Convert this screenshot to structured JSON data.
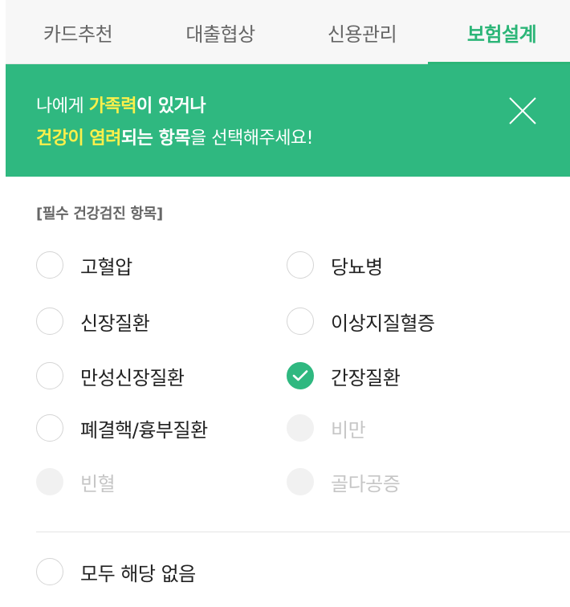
{
  "tabs": [
    {
      "label": "카드추천"
    },
    {
      "label": "대출협상"
    },
    {
      "label": "신용관리"
    },
    {
      "label": "보험설계"
    }
  ],
  "active_tab": "보험설계",
  "banner": {
    "l1_a": "나에게 ",
    "l1_b": "가족력",
    "l1_c": "이 있거나",
    "l2_a": "건강이 염려",
    "l2_b": "되는 항목",
    "l2_c": "을 선택해주세요!",
    "close_icon": "close-icon"
  },
  "section_title": "[필수 건강검진 항목]",
  "options": [
    {
      "label": "고혈압",
      "state": "unchecked"
    },
    {
      "label": "당뇨병",
      "state": "unchecked"
    },
    {
      "label": "신장질환",
      "state": "unchecked"
    },
    {
      "label": "이상지질혈증",
      "state": "unchecked"
    },
    {
      "label": "만성신장질환",
      "state": "unchecked"
    },
    {
      "label": "간장질환",
      "state": "checked"
    },
    {
      "label": "폐결핵/흉부질환",
      "state": "unchecked"
    },
    {
      "label": "비만",
      "state": "disabled"
    },
    {
      "label": "빈혈",
      "state": "disabled"
    },
    {
      "label": "골다공증",
      "state": "disabled"
    }
  ],
  "none_option": {
    "label": "모두 해당 없음",
    "state": "unchecked"
  },
  "colors": {
    "accent": "#2fb880",
    "highlight": "#fdf04a",
    "tab_active": "#2bb577"
  }
}
